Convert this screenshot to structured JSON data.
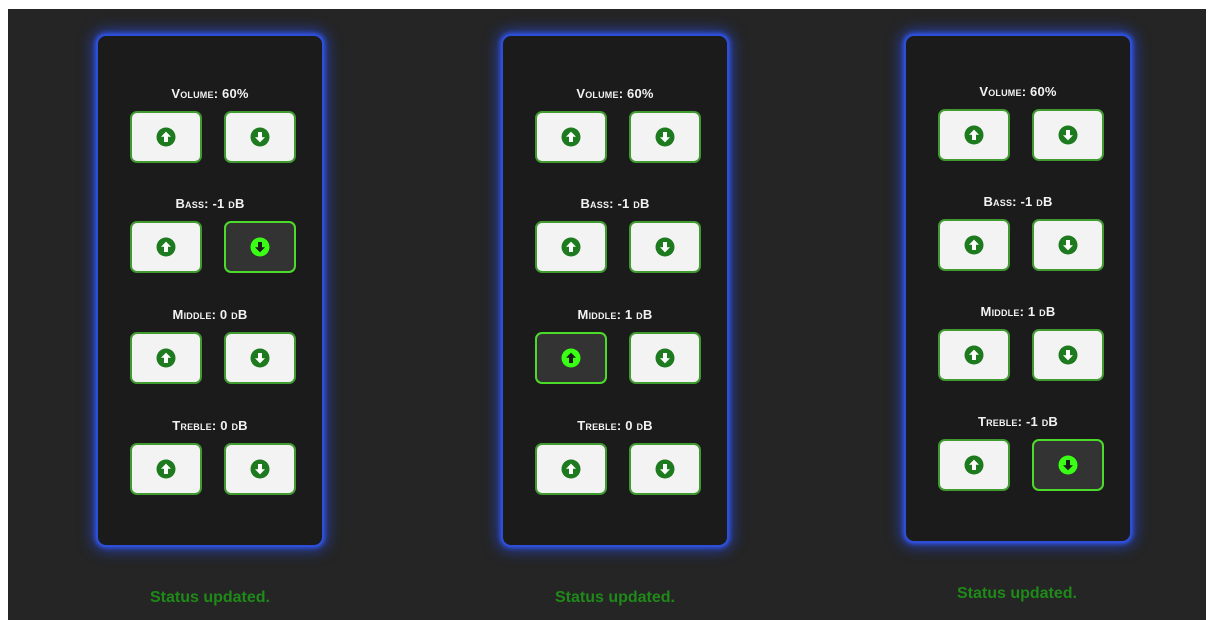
{
  "colors": {
    "background": "#252525",
    "panel": "#1b1b1c",
    "panel_glow": "#2d4fd8",
    "button_border": "#3f9a2f",
    "button_active_border": "#4ddb2a",
    "icon_green": "#1e7a1e",
    "icon_active": "#39ff14",
    "status_text": "#1e8a17"
  },
  "panels": [
    {
      "volume_label": "Volume: 60%",
      "bass_label": "Bass: -1 dB",
      "middle_label": "Middle: 0 dB",
      "treble_label": "Treble: 0 dB",
      "active_button": "bass-down",
      "status": "Status updated."
    },
    {
      "volume_label": "Volume: 60%",
      "bass_label": "Bass: -1 dB",
      "middle_label": "Middle: 1 dB",
      "treble_label": "Treble: 0 dB",
      "active_button": "middle-up",
      "status": "Status updated."
    },
    {
      "volume_label": "Volume: 60%",
      "bass_label": "Bass: -1 dB",
      "middle_label": "Middle: 1 dB",
      "treble_label": "Treble: -1 dB",
      "active_button": "treble-down",
      "status": "Status updated."
    }
  ],
  "icons": {
    "up": "arrow-up-circle-icon",
    "down": "arrow-down-circle-icon"
  }
}
